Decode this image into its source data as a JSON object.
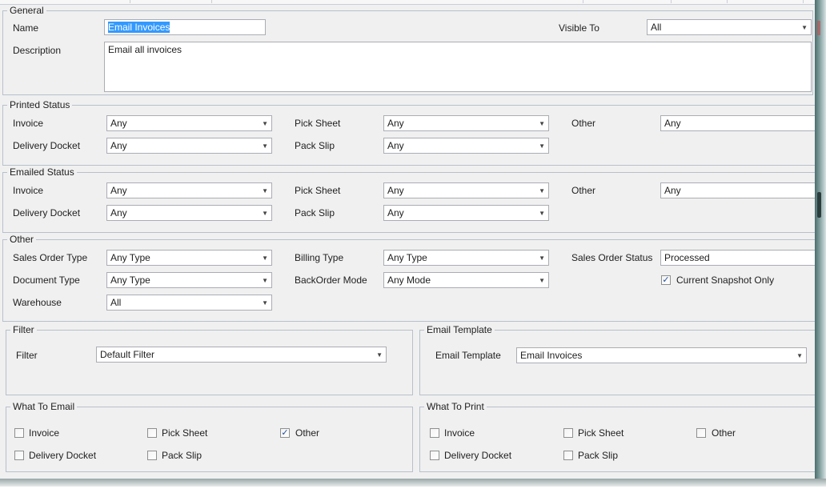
{
  "general": {
    "legend": "General",
    "name_label": "Name",
    "name_value": "Email Invoices",
    "visible_label": "Visible To",
    "visible_value": "All",
    "description_label": "Description",
    "description_value": "Email all invoices"
  },
  "printed": {
    "legend": "Printed Status",
    "invoice_label": "Invoice",
    "invoice_value": "Any",
    "pick_label": "Pick Sheet",
    "pick_value": "Any",
    "other_label": "Other",
    "other_value": "Any",
    "delivery_label": "Delivery Docket",
    "delivery_value": "Any",
    "pack_label": "Pack Slip",
    "pack_value": "Any"
  },
  "emailed": {
    "legend": "Emailed Status",
    "invoice_label": "Invoice",
    "invoice_value": "Any",
    "pick_label": "Pick Sheet",
    "pick_value": "Any",
    "other_label": "Other",
    "other_value": "Any",
    "delivery_label": "Delivery Docket",
    "delivery_value": "Any",
    "pack_label": "Pack Slip",
    "pack_value": "Any"
  },
  "other": {
    "legend": "Other",
    "sales_type_label": "Sales Order Type",
    "sales_type_value": "Any Type",
    "billing_label": "Billing Type",
    "billing_value": "Any Type",
    "status_label": "Sales Order Status",
    "status_value": "Processed",
    "doc_type_label": "Document Type",
    "doc_type_value": "Any Type",
    "backorder_label": "BackOrder Mode",
    "backorder_value": "Any Mode",
    "snapshot_label": "Current Snapshot Only",
    "snapshot_checked": true,
    "warehouse_label": "Warehouse",
    "warehouse_value": "All"
  },
  "filter": {
    "legend": "Filter",
    "label": "Filter",
    "value": "Default Filter"
  },
  "email_template": {
    "legend": "Email Template",
    "label": "Email Template",
    "value": "Email Invoices"
  },
  "what_to_email": {
    "legend": "What To Email",
    "invoice": "Invoice",
    "invoice_checked": false,
    "pick": "Pick Sheet",
    "pick_checked": false,
    "other": "Other",
    "other_checked": true,
    "delivery": "Delivery Docket",
    "delivery_checked": false,
    "pack": "Pack Slip",
    "pack_checked": false
  },
  "what_to_print": {
    "legend": "What To Print",
    "invoice": "Invoice",
    "invoice_checked": false,
    "pick": "Pick Sheet",
    "pick_checked": false,
    "other": "Other",
    "other_checked": false,
    "delivery": "Delivery Docket",
    "delivery_checked": false,
    "pack": "Pack Slip",
    "pack_checked": false
  },
  "icons": {
    "dropdown": "chevron-down-icon",
    "check": "checkmark-icon"
  },
  "colors": {
    "panel": "#f0f0f0",
    "group_border": "#b7c0cc",
    "selection": "#3399ff",
    "check": "#1f4e9c"
  }
}
